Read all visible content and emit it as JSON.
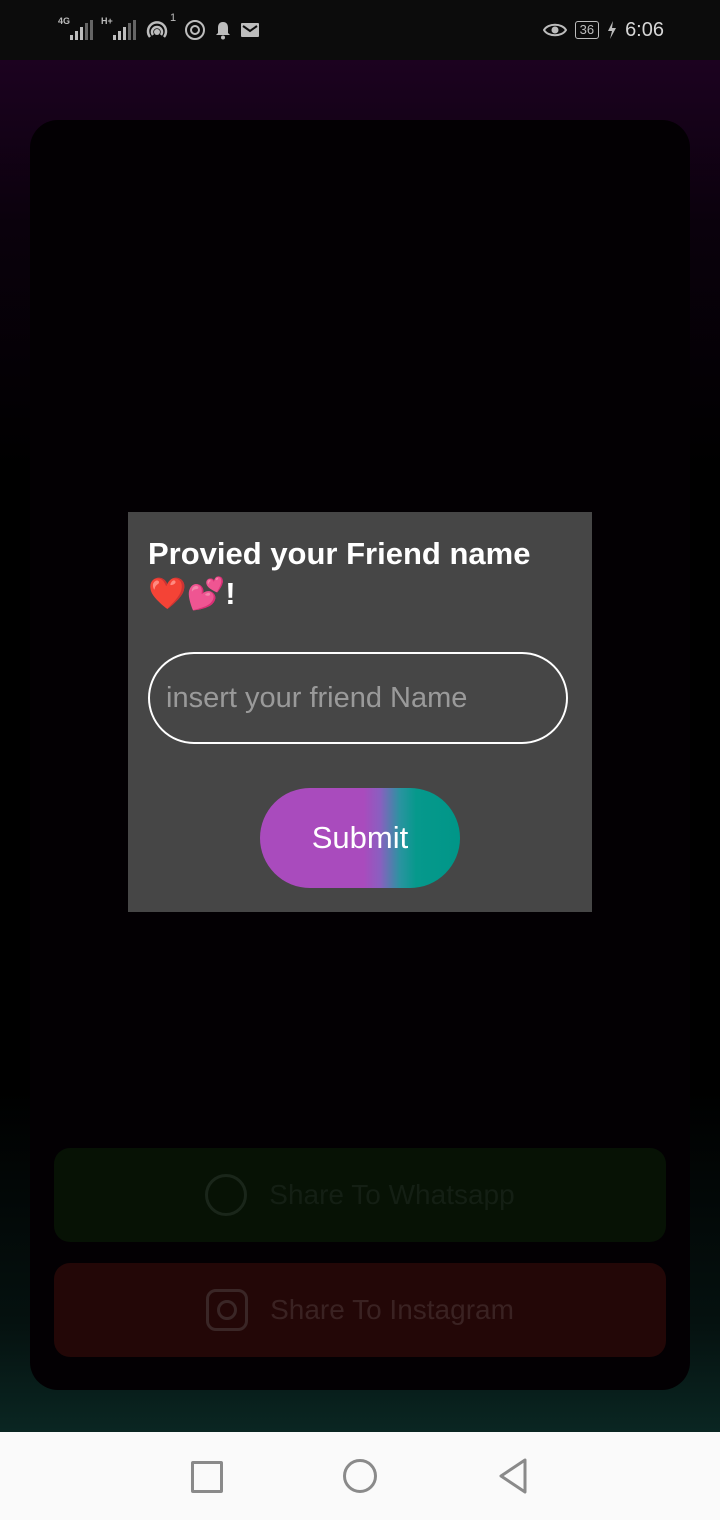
{
  "status_bar": {
    "network_1": "4G",
    "network_2": "H+",
    "notification_count": "1",
    "battery": "36",
    "time": "6:06",
    "icons": [
      "signal-icon",
      "signal-icon",
      "hotspot-icon",
      "nfc-icon",
      "bell-icon",
      "mail-icon",
      "eye-icon",
      "battery-icon",
      "charging-icon"
    ]
  },
  "background": {
    "share_whatsapp_label": "Share To Whatsapp",
    "share_instagram_label": "Share To Instagram"
  },
  "dialog": {
    "title": "Provied your Friend name ❤️💕!",
    "input_placeholder": "insert your friend Name",
    "input_value": "",
    "submit_label": "Submit"
  },
  "colors": {
    "dialog_bg": "#464646",
    "submit_gradient_start": "#a94bbd",
    "submit_gradient_end": "#009688"
  }
}
